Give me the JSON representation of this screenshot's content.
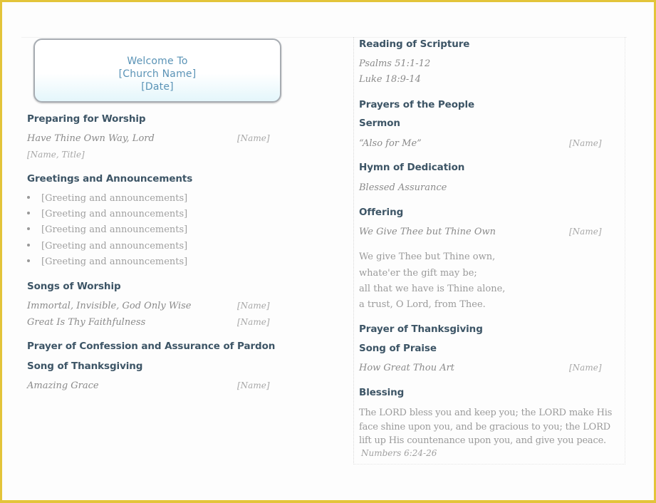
{
  "welcome": {
    "line1": "Welcome To",
    "line2": "[Church Name]",
    "line3": "[Date]"
  },
  "left": {
    "preparing": {
      "heading": "Preparing for Worship",
      "song": "Have Thine Own Way, Lord",
      "name": "[Name]",
      "subtitle": "[Name, Title]"
    },
    "greetings": {
      "heading": "Greetings and Announcements",
      "items": [
        "[Greeting and announcements]",
        "[Greeting and announcements]",
        "[Greeting and announcements]",
        "[Greeting and announcements]",
        "[Greeting and announcements]"
      ]
    },
    "songs_of_worship": {
      "heading": "Songs of Worship",
      "songs": [
        {
          "title": "Immortal, Invisible, God Only Wise",
          "name": "[Name]"
        },
        {
          "title": "Great Is Thy Faithfulness",
          "name": "[Name]"
        }
      ]
    },
    "confession": {
      "heading": "Prayer of Confession and Assurance of Pardon"
    },
    "thanksgiving_song": {
      "heading": "Song of Thanksgiving",
      "song": "Amazing Grace",
      "name": "[Name]"
    }
  },
  "right": {
    "scripture": {
      "heading": "Reading of Scripture",
      "readings": [
        "Psalms 51:1-12",
        "Luke 18:9-14"
      ]
    },
    "prayers": {
      "heading": "Prayers of the People"
    },
    "sermon": {
      "heading": "Sermon",
      "title": "“Also for Me”",
      "name": "[Name]"
    },
    "dedication": {
      "heading": "Hymn of Dedication",
      "song": "Blessed Assurance"
    },
    "offering": {
      "heading": "Offering",
      "song": "We Give Thee but Thine Own",
      "name": "[Name]",
      "lyrics": [
        "We give Thee but Thine own,",
        "whate'er the gift may be;",
        "all that we have is Thine alone,",
        "a trust, O Lord, from Thee."
      ]
    },
    "prayer_thanksgiving": {
      "heading": "Prayer of Thanksgiving"
    },
    "praise": {
      "heading": "Song of Praise",
      "song": "How Great Thou Art",
      "name": "[Name]"
    },
    "blessing": {
      "heading": "Blessing",
      "text": "The LORD bless you and keep you; the LORD make His face shine upon you, and be gracious to you; the LORD lift up His countenance upon you, and give you peace.",
      "citation": "Numbers 6:24-26"
    }
  },
  "colors": {
    "heading": "#3d5566",
    "welcome_text": "#5a93b6",
    "frame": "#e3c43a"
  }
}
